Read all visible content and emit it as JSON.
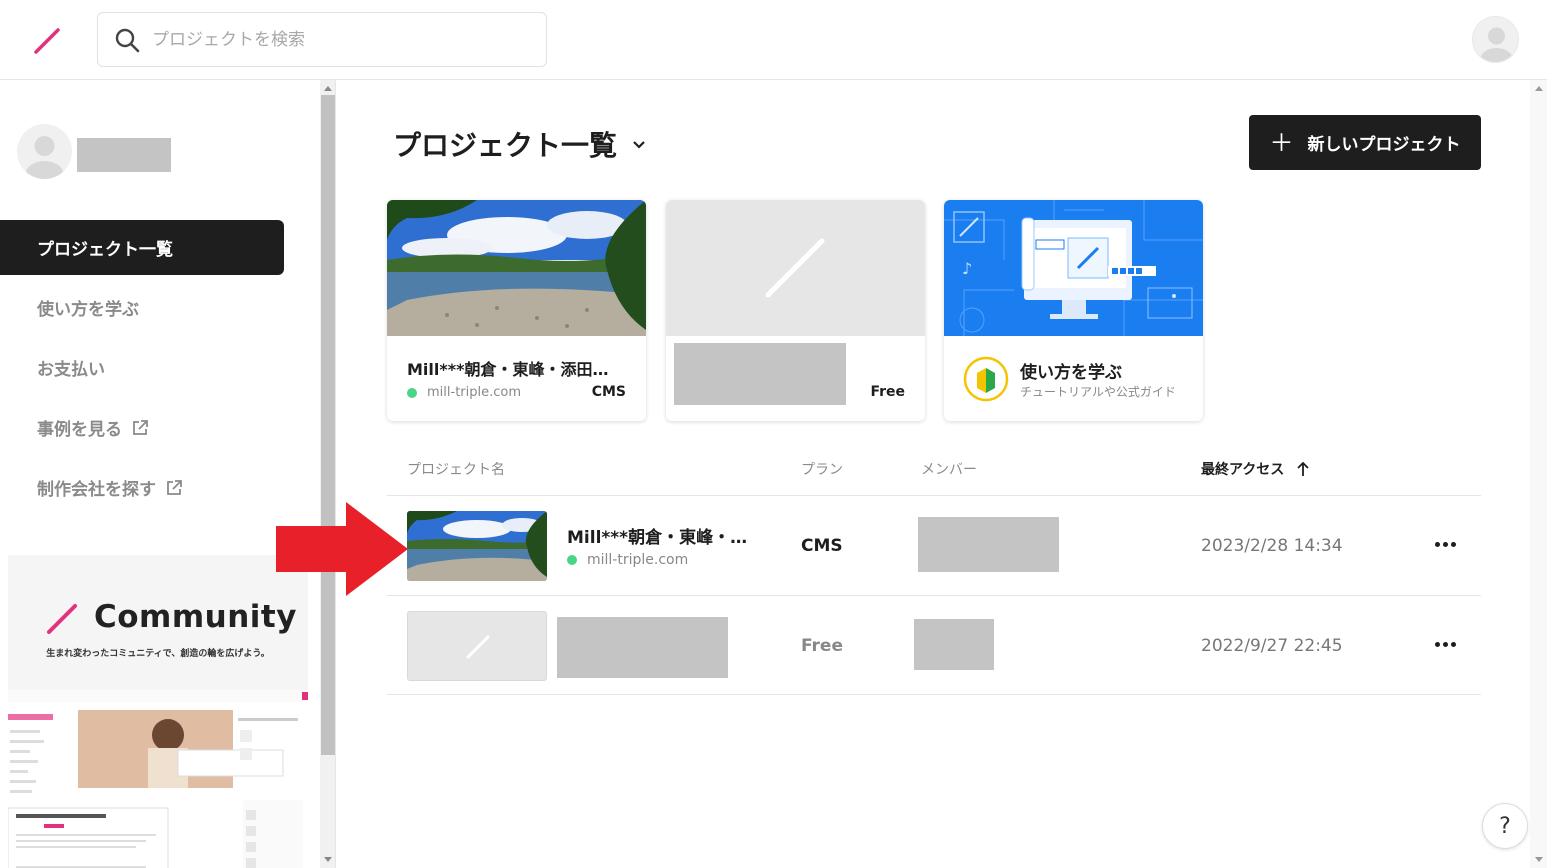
{
  "search": {
    "placeholder": "プロジェクトを検索"
  },
  "colors": {
    "accent": "#e2317d",
    "dark": "#1e1e1e",
    "online_dot": "#4cd38a",
    "annotation_arrow": "#e8202a"
  },
  "sidebar": {
    "items": [
      {
        "label": "プロジェクト一覧",
        "active": true,
        "external": false
      },
      {
        "label": "使い方を学ぶ",
        "active": false,
        "external": false
      },
      {
        "label": "お支払い",
        "active": false,
        "external": false
      },
      {
        "label": "事例を見る",
        "active": false,
        "external": true
      },
      {
        "label": "制作会社を探す",
        "active": false,
        "external": true
      }
    ],
    "community": {
      "title": "Community",
      "subtitle": "生まれ変わったコミュニティで、創造の輪を広げよう。"
    }
  },
  "main": {
    "title": "プロジェクト一覧",
    "new_button": "新しいプロジェクト",
    "cards": [
      {
        "name": "Mill***朝倉・東峰・添田…",
        "domain": "mill-triple.com",
        "plan": "CMS"
      },
      {
        "name": "",
        "domain": "",
        "plan": "Free"
      },
      {
        "learn_title": "使い方を学ぶ",
        "learn_sub": "チュートリアルや公式ガイド"
      }
    ],
    "table": {
      "headers": {
        "name": "プロジェクト名",
        "plan": "プラン",
        "members": "メンバー",
        "last_access": "最終アクセス"
      },
      "rows": [
        {
          "name": "Mill***朝倉・東峰・…",
          "domain": "mill-triple.com",
          "plan": "CMS",
          "date": "2023/2/28 14:34"
        },
        {
          "name": "",
          "domain": "",
          "plan": "Free",
          "date": "2022/9/27 22:45"
        }
      ]
    }
  },
  "help": {
    "label": "?"
  }
}
